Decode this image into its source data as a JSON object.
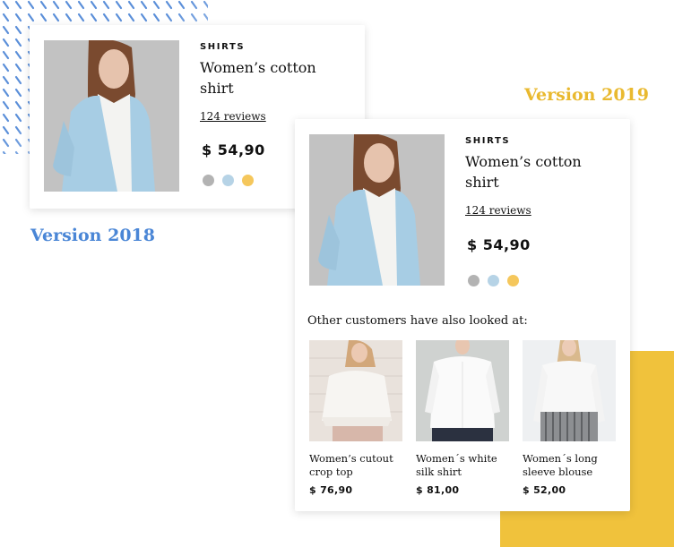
{
  "versions": {
    "v2018": "Version 2018",
    "v2019": "Version 2019"
  },
  "colors": {
    "blue": "#4a86d6",
    "yellow": "#f0c23c"
  },
  "product": {
    "category": "SHIRTS",
    "title": "Women’s cotton shirt",
    "reviews": "124 reviews",
    "price": "$ 54,90",
    "swatches": [
      "#b3b3b3",
      "#b6d3e6",
      "#f5c75c"
    ]
  },
  "recommendations": {
    "heading": "Other customers have also looked at:",
    "items": [
      {
        "name": "Women’s cutout crop top",
        "price": "$ 76,90"
      },
      {
        "name": "Women´s white silk shirt",
        "price": "$ 81,00"
      },
      {
        "name": "Women´s long sleeve blouse",
        "price": "$ 52,00"
      }
    ]
  }
}
